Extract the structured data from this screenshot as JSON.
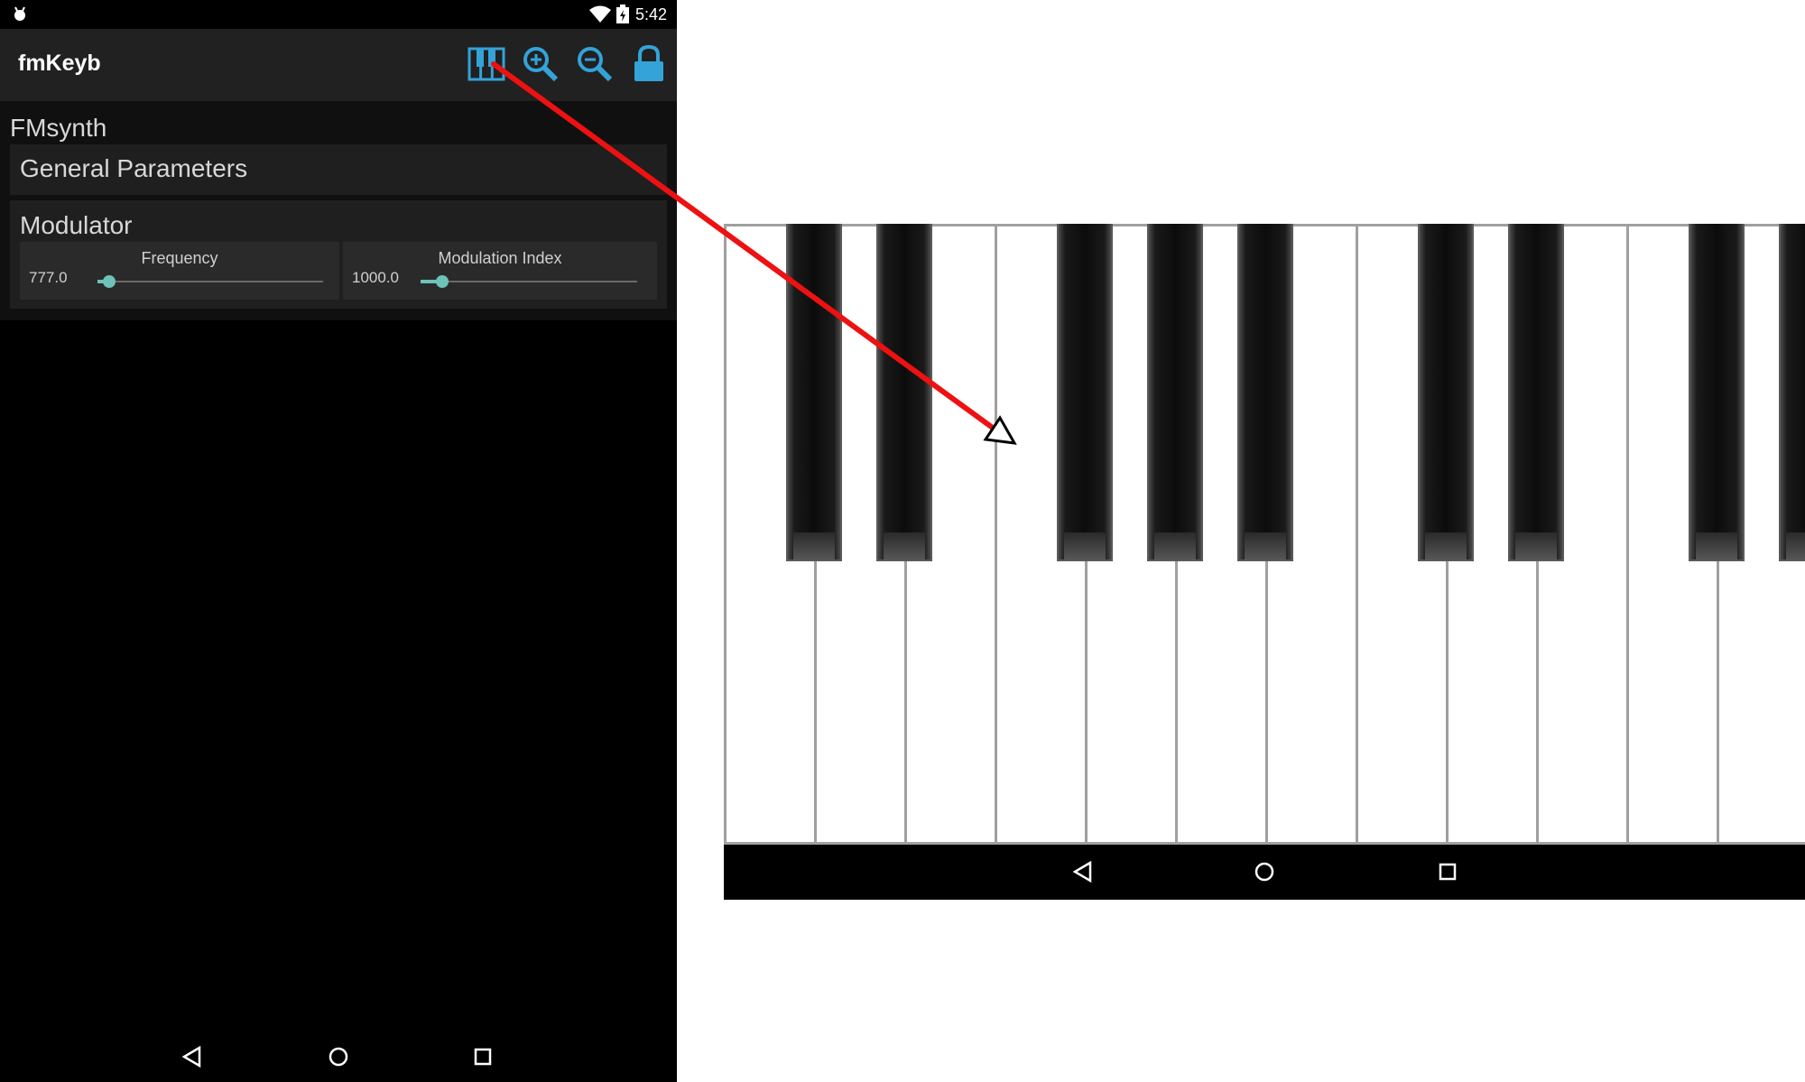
{
  "status_bar": {
    "time": "5:42"
  },
  "app_bar": {
    "title": "fmKeyb",
    "actions": [
      "piano-keyboard-icon",
      "zoom-in-icon",
      "zoom-out-icon",
      "lock-icon"
    ]
  },
  "content": {
    "section_title": "FMsynth",
    "general": {
      "label": "General Parameters"
    },
    "modulator": {
      "label": "Modulator",
      "params": [
        {
          "label": "Frequency",
          "value": "777.0",
          "fraction": 0.05
        },
        {
          "label": "Modulation Index",
          "value": "1000.0",
          "fraction": 0.1
        }
      ]
    }
  },
  "nav_buttons": [
    "back-icon",
    "home-icon",
    "recents-icon"
  ],
  "keyboard": {
    "white_keys": 12,
    "black_key_pattern": [
      1,
      1,
      0,
      1,
      1,
      1,
      0,
      1,
      1,
      0,
      1,
      1
    ]
  },
  "colors": {
    "accent": "#6cc3b8",
    "icon_blue": "#33a3d8",
    "annotation_arrow": "#ee1111"
  }
}
